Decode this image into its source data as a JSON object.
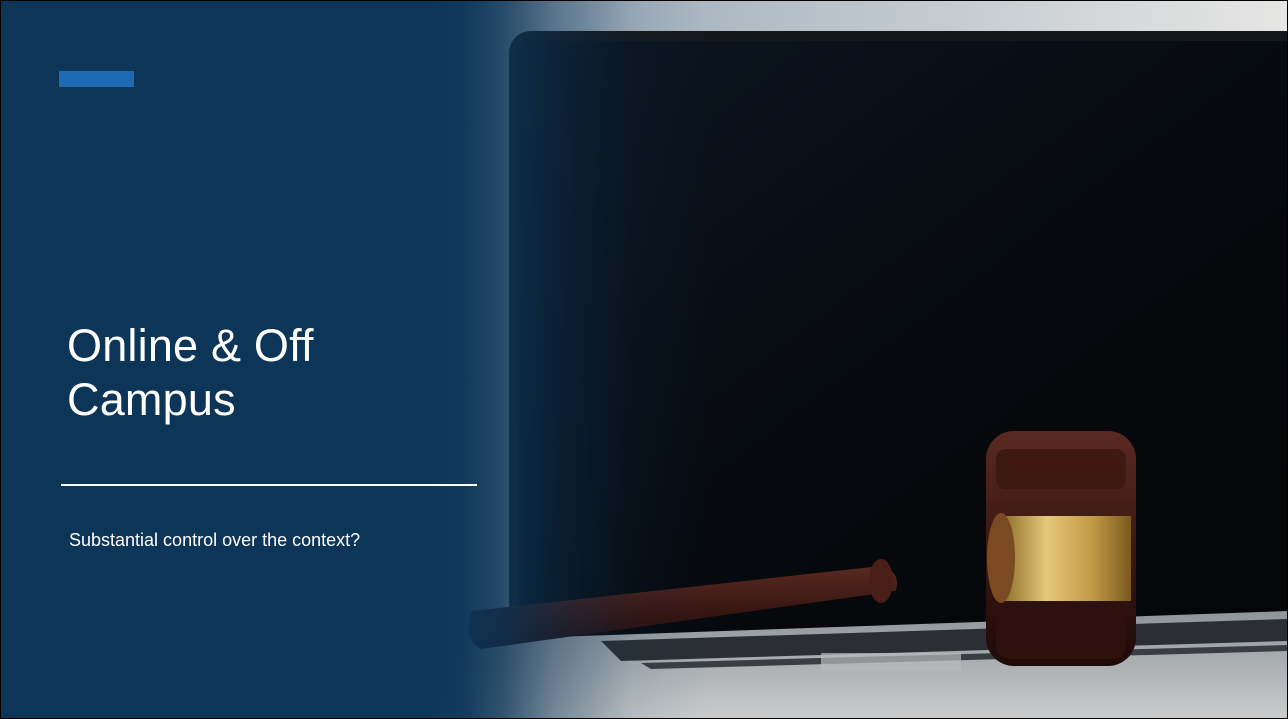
{
  "slide": {
    "title_line1": "Online & Off",
    "title_line2": "Campus",
    "subtitle": "Substantial control over the context?",
    "background_image": "laptop-with-judge-gavel",
    "colors": {
      "background": "#0c3558",
      "accent": "#1f6bb3",
      "text": "#ffffff"
    }
  }
}
